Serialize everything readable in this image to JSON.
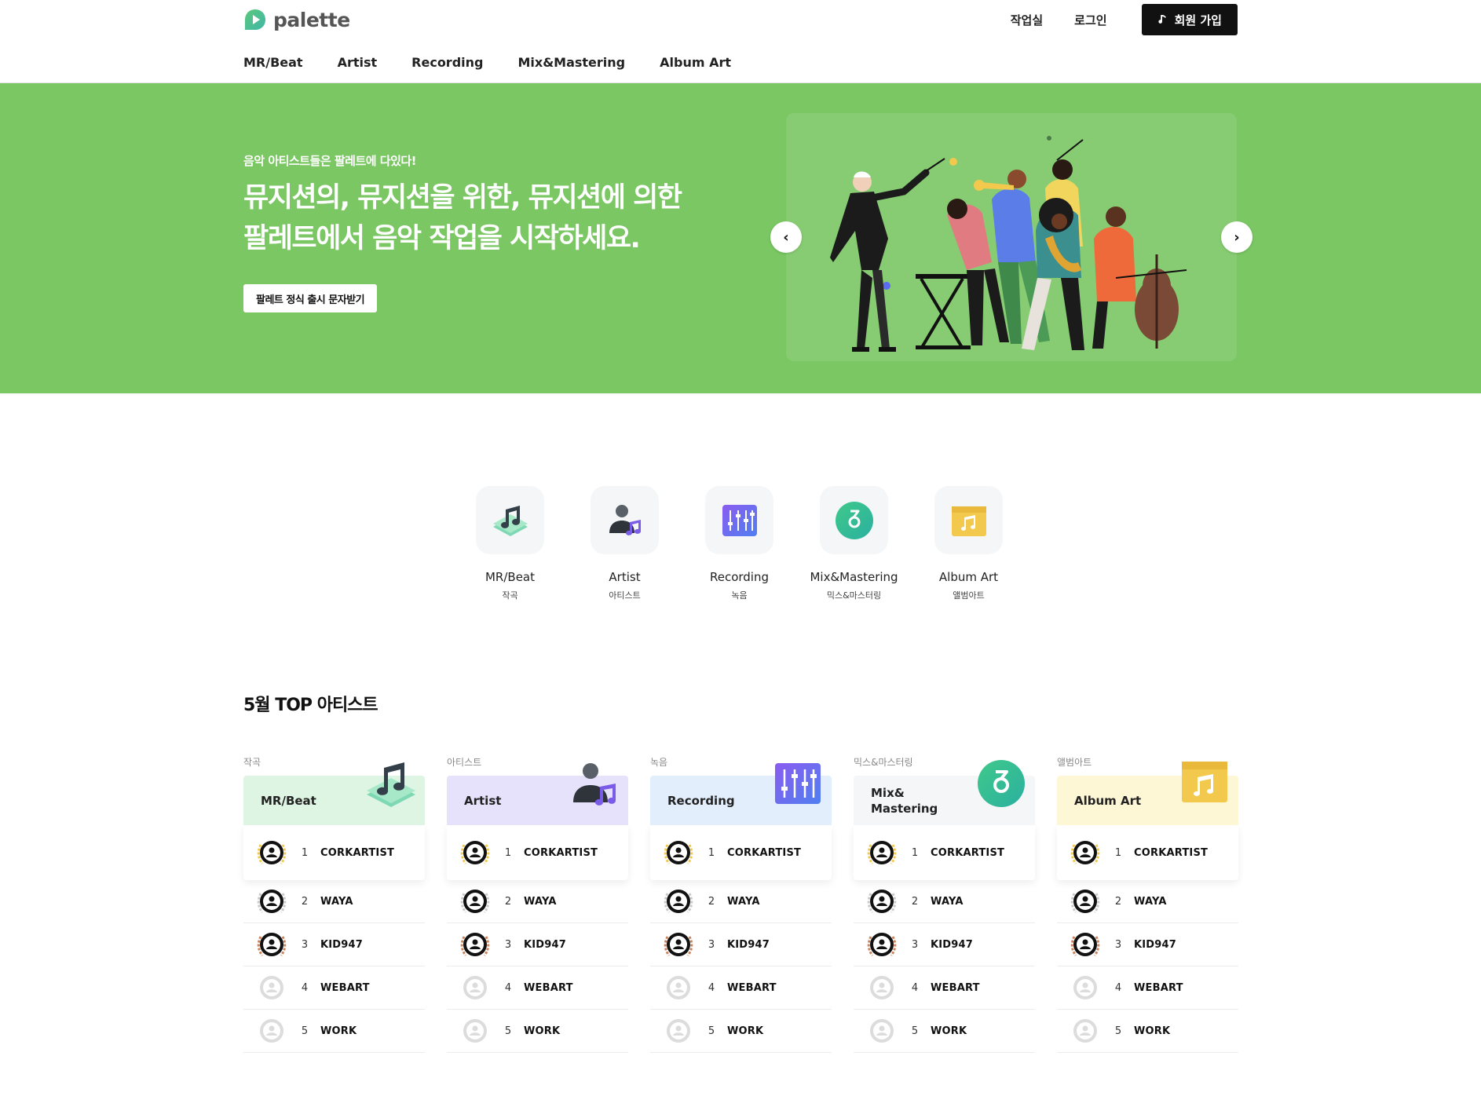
{
  "header": {
    "logo_text": "palette",
    "links": {
      "studio": "작업실",
      "login": "로그인",
      "signup": "회원 가입"
    },
    "nav": [
      "MR/Beat",
      "Artist",
      "Recording",
      "Mix&Mastering",
      "Album Art"
    ]
  },
  "hero": {
    "eyebrow": "음악 아티스트들은 팔레트에 다있다!",
    "title_line1": "뮤지션의, 뮤지션을 위한, 뮤지션에 의한",
    "title_line2": "팔레트에서 음악 작업을 시작하세요.",
    "cta": "팔레트 정식 출시 문자받기",
    "prev_arrow": "‹",
    "next_arrow": "›"
  },
  "categories": [
    {
      "name": "MR/Beat",
      "sub": "작곡",
      "icon": "music-notes-icon"
    },
    {
      "name": "Artist",
      "sub": "아티스트",
      "icon": "artist-icon"
    },
    {
      "name": "Recording",
      "sub": "녹음",
      "icon": "mixer-sliders-icon"
    },
    {
      "name": "Mix&Mastering",
      "sub": "믹스&마스터링",
      "icon": "mastering-disc-icon"
    },
    {
      "name": "Album Art",
      "sub": "앨범아트",
      "icon": "album-folder-icon"
    }
  ],
  "top_section": {
    "title": "5월 TOP 아티스트",
    "boards": [
      {
        "caption": "작곡",
        "label": "MR/Beat",
        "color": "#dff5e3"
      },
      {
        "caption": "아티스트",
        "label": "Artist",
        "color": "#e7e2fb"
      },
      {
        "caption": "녹음",
        "label": "Recording",
        "color": "#e3eefc"
      },
      {
        "caption": "믹스&마스터링",
        "label": "Mix& Mastering",
        "color": "#f4f6f8"
      },
      {
        "caption": "앨범아트",
        "label": "Album Art",
        "color": "#fdf7d6"
      }
    ],
    "ranks": [
      {
        "rank": "1",
        "name": "CORKARTIST"
      },
      {
        "rank": "2",
        "name": "WAYA"
      },
      {
        "rank": "3",
        "name": "KID947"
      },
      {
        "rank": "4",
        "name": "WEBART"
      },
      {
        "rank": "5",
        "name": "WORK"
      }
    ]
  },
  "colors": {
    "hero_bg": "#7ac763",
    "hero_art_bg": "#87cc72",
    "signup_bg": "#111111",
    "gold": "#f2c94c",
    "silver": "#c9c9c9",
    "bronze": "#c9825a"
  }
}
